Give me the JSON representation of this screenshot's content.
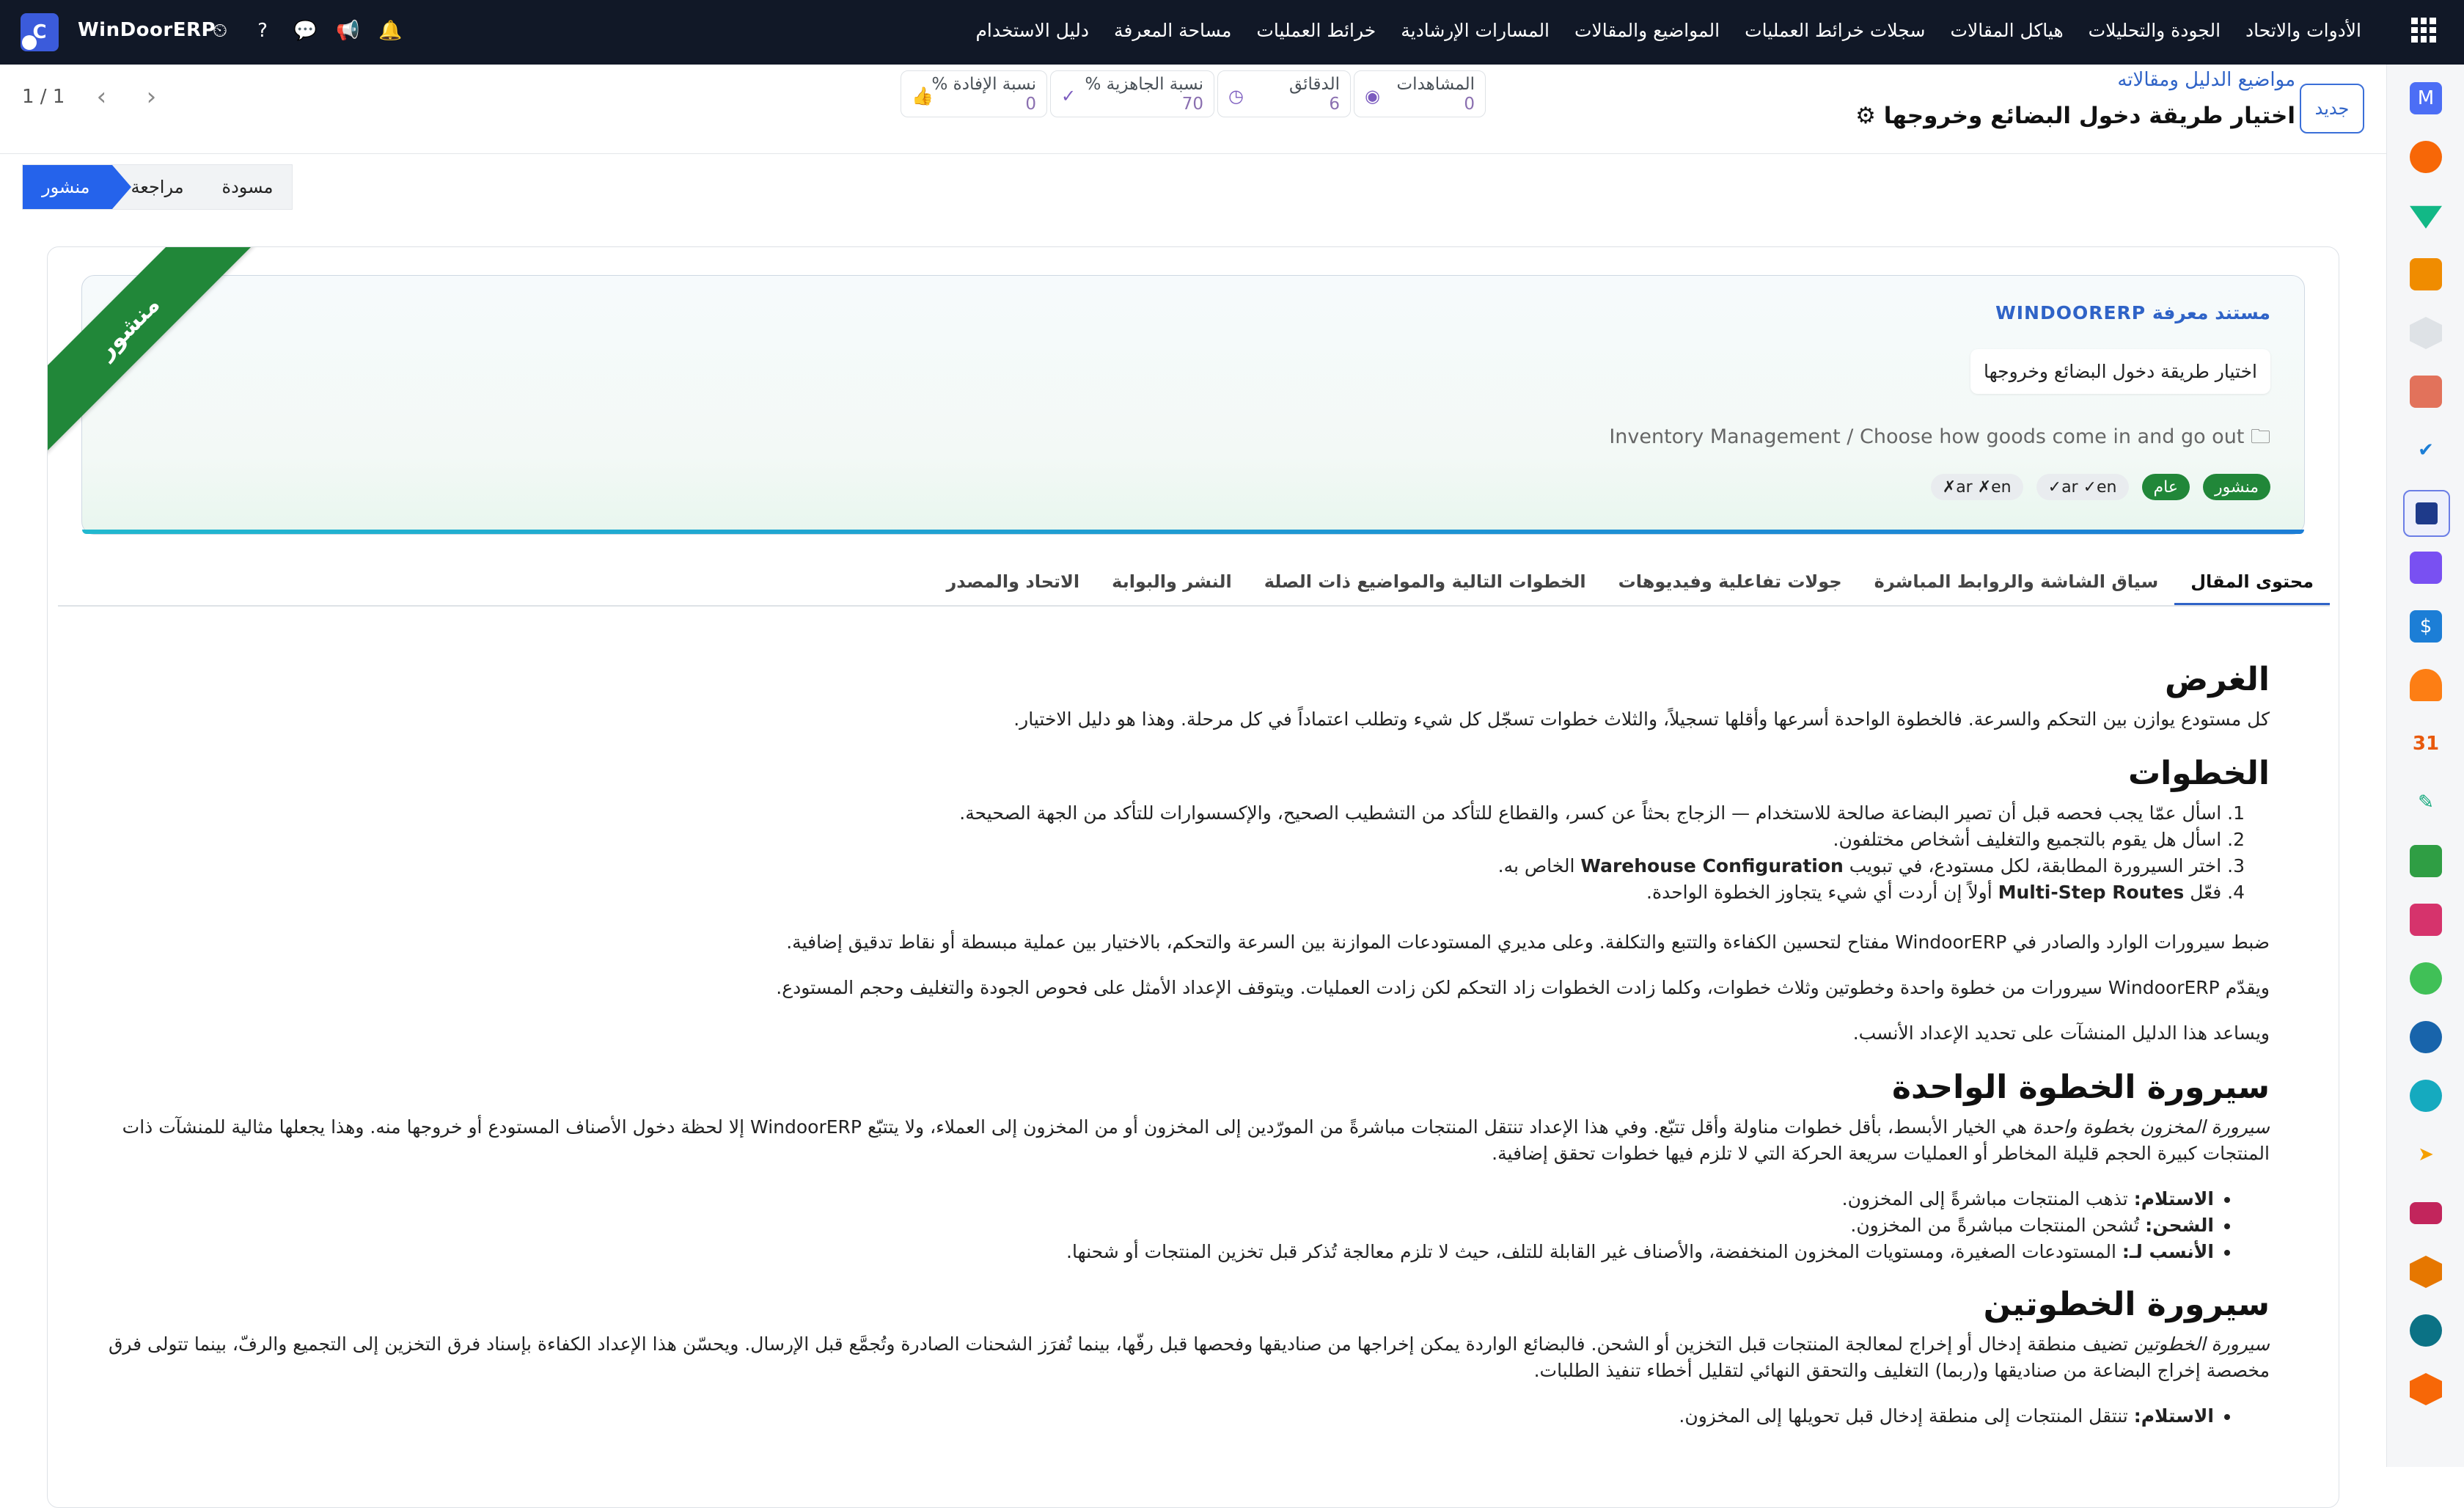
{
  "app": {
    "name": "WinDoorERP",
    "logo_letter": "C"
  },
  "topbar": {
    "menu": [
      "دليل الاستخدام",
      "مساحة المعرفة",
      "خرائط العمليات",
      "المسارات الإرشادية",
      "المواضيع والمقالات",
      "سجلات خرائط العمليات",
      "هياكل المقالات",
      "الجودة والتحليلات",
      "الأدوات والاتحاد"
    ],
    "icons": [
      "clock-icon",
      "help-icon",
      "chat-icon",
      "megaphone-icon",
      "bell-icon"
    ],
    "icon_glyphs": [
      "⏲",
      "?",
      "💬",
      "📢",
      "🔔"
    ]
  },
  "control_panel": {
    "new_button": "جديد",
    "breadcrumb": "مواضيع الدليل ومقالاته",
    "record_title": "اختيار طريقة دخول البضائع وخروجها",
    "pager": "1 / 1",
    "stats": [
      {
        "label": "المشاهدات",
        "value": "0",
        "icon": "eye-icon"
      },
      {
        "label": "الدقائق",
        "value": "6",
        "icon": "clock-icon"
      },
      {
        "label": "نسبة الجاهزية %",
        "value": "70",
        "icon": "check-circle-icon"
      },
      {
        "label": "نسبة الإفادة %",
        "value": "0",
        "icon": "thumbs-up-icon"
      }
    ]
  },
  "statusbar": {
    "stages": [
      "منشور",
      "مراجعة",
      "مسودة"
    ],
    "current": "منشور"
  },
  "hero": {
    "ribbon": "منشور",
    "kicker": "مستند معرفة WINDOORERP",
    "summary": "اختيار طريقة دخول البضائع وخروجها",
    "path": "Inventory Management / Choose how goods come in and go out",
    "tags": [
      "منشور",
      "عام",
      "ar ✓en✓",
      "ar ✗en✗"
    ]
  },
  "tabs": [
    "محتوى المقال",
    "سياق الشاشة والروابط المباشرة",
    "جولات تفاعلية وفيديوهات",
    "الخطوات التالية والمواضيع ذات الصلة",
    "النشر والبوابة",
    "الاتحاد والمصدر"
  ],
  "article": {
    "h_purpose": "الغرض",
    "purpose": "كل مستودع يوازن بين التحكم والسرعة. فالخطوة الواحدة أسرعها وأقلها تسجيلاً، والثلاث خطوات تسجّل كل شيء وتطلب اعتماداً في كل مرحلة. وهذا هو دليل الاختيار.",
    "h_steps": "الخطوات",
    "steps": [
      {
        "n": "1.",
        "pre": "اسأل عمّا يجب فحصه قبل أن تصير البضاعة صالحة للاستخدام — الزجاج بحثاً عن كسر، والقطاع للتأكد من التشطيب الصحيح، والإكسسوارات للتأكد من الجهة الصحيحة.",
        "bold": "",
        "post": ""
      },
      {
        "n": "2.",
        "pre": "اسأل هل يقوم بالتجميع والتغليف أشخاص مختلفون.",
        "bold": "",
        "post": ""
      },
      {
        "n": "3.",
        "pre": "اختر السيرورة المطابقة، لكل مستودع، في تبويب ",
        "bold": "Warehouse Configuration",
        "post": " الخاص به."
      },
      {
        "n": "4.",
        "pre": "فعّل ",
        "bold": "Multi-Step Routes",
        "post": " أولاً إن أردت أي شيء يتجاوز الخطوة الواحدة."
      }
    ],
    "para1": "ضبط سيرورات الوارد والصادر في WindoorERP مفتاح لتحسين الكفاءة والتتبع والتكلفة. وعلى مديري المستودعات الموازنة بين السرعة والتحكم، بالاختيار بين عملية مبسطة أو نقاط تدقيق إضافية.",
    "para2": "ويقدّم WindoorERP سيرورات من خطوة واحدة وخطوتين وثلاث خطوات، وكلما زادت الخطوات زاد التحكم لكن زادت العمليات. ويتوقف الإعداد الأمثل على فحوص الجودة والتغليف وحجم المستودع.",
    "para3": "ويساعد هذا الدليل المنشآت على تحديد الإعداد الأنسب.",
    "h_one": "سيرورة الخطوة الواحدة",
    "one_em": "سيرورة المخزون بخطوة واحدة",
    "one_text": " هي الخيار الأبسط، بأقل خطوات مناولة وأقل تتبّع. وفي هذا الإعداد تنتقل المنتجات مباشرةً من المورّدين إلى المخزون أو من المخزون إلى العملاء، ولا يتتبّع WindoorERP إلا لحظة دخول الأصناف المستودع أو خروجها منه. وهذا يجعلها مثالية للمنشآت ذات المنتجات كبيرة الحجم قليلة المخاطر أو العمليات سريعة الحركة التي لا تلزم فيها خطوات تحقق إضافية.",
    "one_bullets": [
      {
        "b": "الاستلام:",
        "t": " تذهب المنتجات مباشرةً إلى المخزون."
      },
      {
        "b": "الشحن:",
        "t": " تُشحن المنتجات مباشرةً من المخزون."
      },
      {
        "b": "الأنسب لـ:",
        "t": " المستودعات الصغيرة، ومستويات المخزون المنخفضة، والأصناف غير القابلة للتلف، حيث لا تلزم معالجة تُذكر قبل تخزين المنتجات أو شحنها."
      }
    ],
    "h_two": "سيرورة الخطوتين",
    "two_em": "سيرورة الخطوتين",
    "two_text": " تضيف منطقة إدخال أو إخراج لمعالجة المنتجات قبل التخزين أو الشحن. فالبضائع الواردة يمكن إخراجها من صناديقها وفحصها قبل رفّها، بينما تُفرَز الشحنات الصادرة وتُجمَّع قبل الإرسال. ويحسّن هذا الإعداد الكفاءة بإسناد فرق التخزين إلى التجميع والرفّ، بينما تتولى فرق مخصصة إخراج البضاعة من صناديقها و(ربما) التغليف والتحقق النهائي لتقليل أخطاء تنفيذ الطلبات.",
    "two_bullets": [
      {
        "b": "الاستلام:",
        "t": " تنتقل المنتجات إلى منطقة إدخال قبل تحويلها إلى المخزون."
      }
    ]
  }
}
